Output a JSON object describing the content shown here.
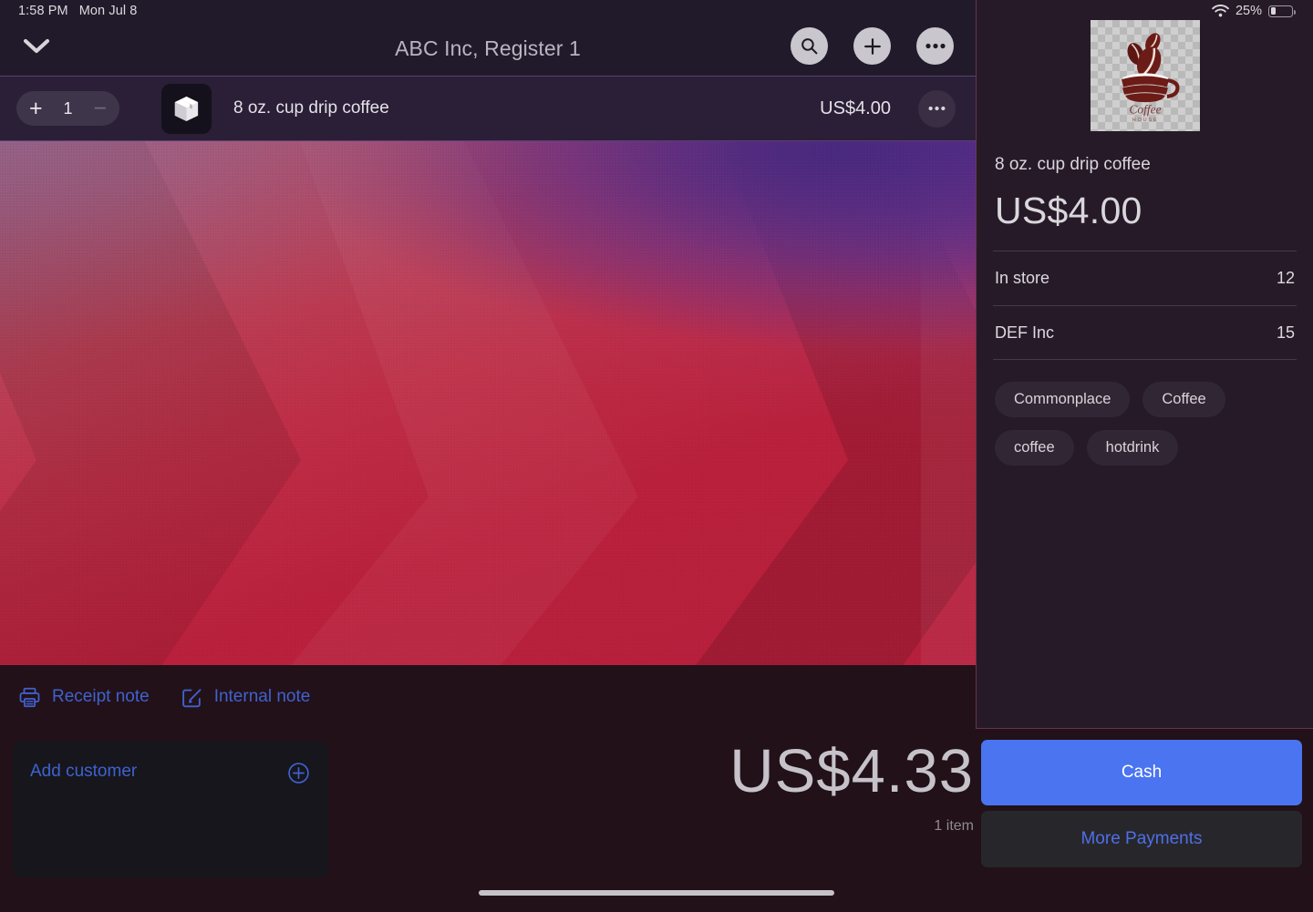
{
  "status_bar": {
    "time": "1:58 PM",
    "date": "Mon Jul 8",
    "wifi_icon": "wifi-icon",
    "battery_percent": "25%",
    "battery_level": 25,
    "battery_icon": "battery-icon"
  },
  "header": {
    "title": "ABC Inc, Register 1",
    "collapse_icon": "chevron-down-icon",
    "actions": [
      {
        "name": "search-icon",
        "label": "Search"
      },
      {
        "name": "plus-icon",
        "label": "Add"
      },
      {
        "name": "ellipsis-icon",
        "label": "More options"
      }
    ]
  },
  "cart": {
    "line_item": {
      "quantity": "1",
      "increase_label": "+",
      "decrease_label": "−",
      "thumbnail_icon": "package-box-icon",
      "name": "8 oz. cup drip coffee",
      "price": "US$4.00",
      "more_icon": "ellipsis-icon"
    }
  },
  "notes": {
    "receipt_note": {
      "label": "Receipt note",
      "icon": "printer-icon"
    },
    "internal_note": {
      "label": "Internal note",
      "icon": "edit-square-icon"
    }
  },
  "product_detail": {
    "image_alt": "Coffee House logo",
    "image_caption_primary": "Coffee",
    "image_caption_secondary": "HOUSE",
    "name": "8 oz. cup drip coffee",
    "price": "US$4.00",
    "inventory": [
      {
        "label": "In store",
        "count": "12"
      },
      {
        "label": "DEF Inc",
        "count": "15"
      }
    ],
    "tags": [
      "Commonplace",
      "Coffee",
      "coffee",
      "hotdrink"
    ]
  },
  "checkout": {
    "add_customer_label": "Add customer",
    "add_customer_icon": "circle-plus-icon",
    "total": "US$4.33",
    "item_count": "1 item",
    "cash_label": "Cash",
    "more_payments_label": "More Payments"
  },
  "colors": {
    "accent_blue": "#4a74f0",
    "link_blue": "#3f62cf",
    "panel_bg": "#261a28",
    "bottom_bg": "#221118",
    "header_bg": "#211a2b",
    "divider": "#6b3246"
  }
}
